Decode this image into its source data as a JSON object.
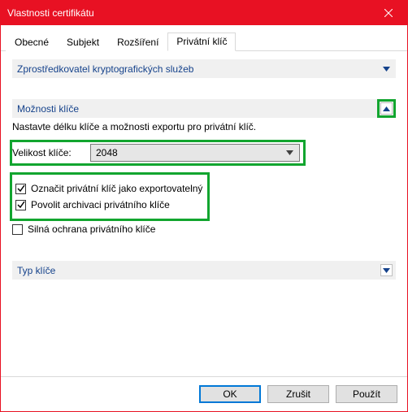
{
  "window": {
    "title": "Vlastnosti certifikátu"
  },
  "tabs": {
    "items": [
      {
        "label": "Obecné"
      },
      {
        "label": "Subjekt"
      },
      {
        "label": "Rozšíření"
      },
      {
        "label": "Privátní klíč"
      }
    ],
    "activeIndex": 3
  },
  "sections": {
    "provider": {
      "title": "Zprostředkovatel kryptografických služeb"
    },
    "keyOptions": {
      "title": "Možnosti klíče",
      "hint": "Nastavte délku klíče a možnosti exportu pro privátní klíč.",
      "sizeLabel": "Velikost klíče:",
      "sizeValue": "2048",
      "checks": {
        "exportable": {
          "label": "Označit privátní klíč jako exportovatelný",
          "checked": true
        },
        "archive": {
          "label": "Povolit archivaci privátního klíče",
          "checked": true
        },
        "strong": {
          "label": "Silná ochrana privátního klíče",
          "checked": false
        }
      }
    },
    "keyType": {
      "title": "Typ klíče"
    }
  },
  "footer": {
    "ok": "OK",
    "cancel": "Zrušit",
    "apply": "Použít"
  }
}
